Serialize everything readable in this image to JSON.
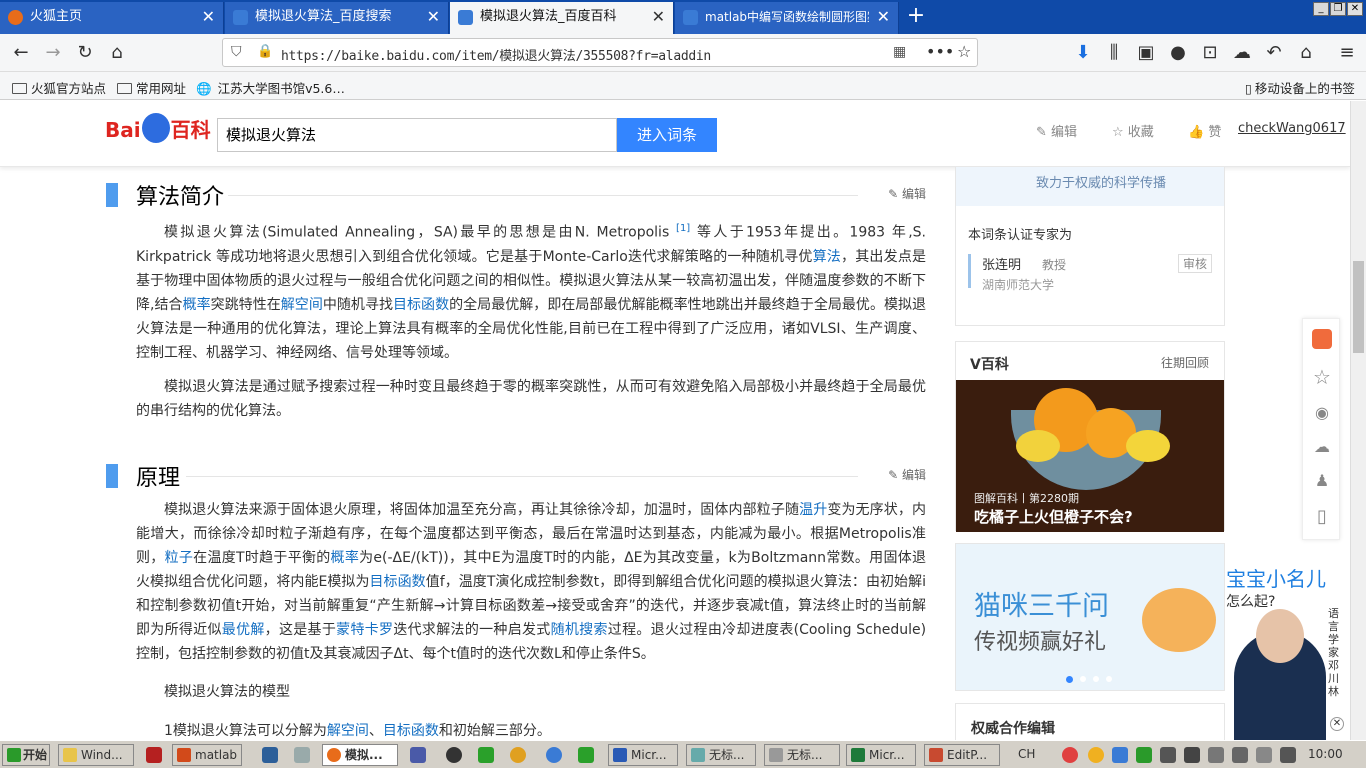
{
  "browser": {
    "tabs": [
      {
        "label": "火狐主页",
        "active": false
      },
      {
        "label": "模拟退火算法_百度搜索",
        "active": false
      },
      {
        "label": "模拟退火算法_百度百科",
        "active": true
      },
      {
        "label": "matlab中编写函数绘制圆形图案",
        "active": false
      }
    ],
    "url": "https://baike.baidu.com/item/模拟退火算法/355508?fr=aladdin",
    "bookmarks": [
      "火狐官方站点",
      "常用网址",
      "江苏大学图书馆v5.6…"
    ],
    "mobile_bookmarks": "移动设备上的书签"
  },
  "header": {
    "logo_text_left": "Bai",
    "logo_text_right": "百科",
    "search_value": "模拟退火算法",
    "enter_button": "进入词条",
    "edit": "编辑",
    "favorite": "收藏",
    "like": "赞",
    "user": "checkWang0617"
  },
  "article": {
    "section1": {
      "title": "算法简介",
      "edit": "编辑",
      "p1": [
        "模拟退火算法(Simulated Annealing，SA)最早的思想是由N. Metropolis ",
        "[1]",
        " 等人于1953年提出。1983 年,S. Kirkpatrick 等成功地将退火思想引入到组合优化领域。它是基于Monte-Carlo迭代求解策略的一种随机寻优",
        "算法",
        "，其出发点是基于物理中固体物质的退火过程与一般组合优化问题之间的相似性。模拟退火算法从某一较高初温出发，伴随温度参数的不断下降,结合",
        "概率",
        "突跳特性在",
        "解空间",
        "中随机寻找",
        "目标函数",
        "的全局最优解，即在局部最优解能概率性地跳出并最终趋于全局最优。模拟退火算法是一种通用的优化算法，理论上算法具有概率的全局优化性能,目前已在工程中得到了广泛应用，诸如VLSI、生产调度、控制工程、机器学习、神经网络、信号处理等领域。"
      ],
      "p2": "模拟退火算法是通过赋予搜索过程一种时变且最终趋于零的概率突跳性，从而可有效避免陷入局部极小并最终趋于全局最优的串行结构的优化算法。"
    },
    "section2": {
      "title": "原理",
      "edit": "编辑",
      "p1": [
        "模拟退火算法来源于固体退火原理，将固体加温至充分高，再让其徐徐冷却，加温时，固体内部粒子随",
        "温升",
        "变为无序状，内能增大，而徐徐冷却时粒子渐趋有序，在每个温度都达到平衡态，最后在常温时达到基态，内能减为最小。根据Metropolis准则，",
        "粒子",
        "在温度T时趋于平衡的",
        "概率",
        "为e(-ΔE/(kT))，其中E为温度T时的内能，ΔE为其改变量，k为Boltzmann常数。用固体退火模拟组合优化问题，将内能E模拟为",
        "目标函数",
        "值f，温度T演化成控制参数t，即得到解组合优化问题的模拟退火算法：由初始解i和控制参数初值t开始，对当前解重复“产生新解→计算目标函数差→接受或舍弃”的迭代，并逐步衰减t值，算法终止时的当前解即为所得近似",
        "最优解",
        "，这是基于",
        "蒙特卡罗",
        "迭代求解法的一种启发式",
        "随机搜索",
        "过程。退火过程由冷却进度表(Cooling Schedule)控制，包括控制参数的初值t及其衰减因子Δt、每个t值时的迭代次数L和停止条件S。"
      ],
      "p2": "模拟退火算法的模型",
      "p3": [
        "1模拟退火算法可以分解为",
        "解空间",
        "、",
        "目标函数",
        "和初始解三部分。"
      ]
    }
  },
  "sidebar": {
    "top_slogan": "致力于权威的科学传播",
    "expert_title": "本词条认证专家为",
    "expert_name": "张连明",
    "expert_rank": "教授",
    "expert_org": "湖南师范大学",
    "expert_badge": "审核",
    "vbaike_title": "V百科",
    "vbaike_more": "往期回顾",
    "vbaike_caption_small": "图解百科丨第2280期",
    "vbaike_caption": "吃橘子上火但橙子不会?",
    "ad_line1": "猫咪三千问",
    "ad_line2": "传视频赢好礼",
    "partner_title": "权威合作编辑"
  },
  "popup": {
    "title": "宝宝小名儿",
    "subtitle": "怎么起?",
    "vertical": "语言学家邓川林"
  },
  "taskbar": {
    "start": "开始",
    "items": [
      "Wind...",
      "matlab",
      "模拟...",
      "Micr...",
      "无标...",
      "无标...",
      "Micr...",
      "EditP..."
    ],
    "lang": "CH",
    "clock": "10:00"
  },
  "colors": {
    "accent": "#3385ff",
    "link": "#136ec2",
    "section_bar": "#4f9cee",
    "logo_red": "#de2520",
    "tab_bar": "#0f4aa8"
  }
}
